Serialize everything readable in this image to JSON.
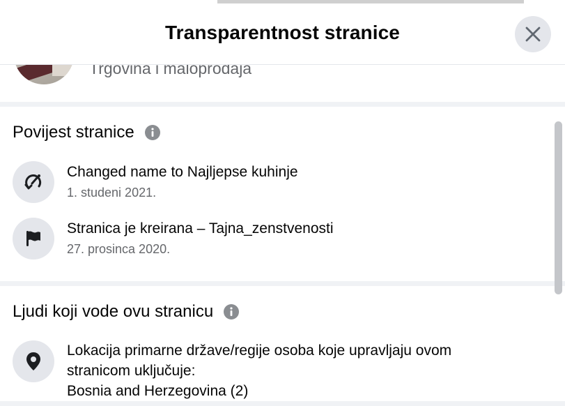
{
  "dialog": {
    "title": "Transparentnost stranice"
  },
  "profile": {
    "category": "Trgovina i maloprodaja"
  },
  "page_history": {
    "title": "Povijest stranice",
    "items": [
      {
        "icon": "name-change-icon",
        "text": "Changed name to Najljepse kuhinje",
        "date": "1. studeni 2021."
      },
      {
        "icon": "flag-icon",
        "text": "Stranica je kreirana – Tajna_zenstvenosti",
        "date": "27. prosinca 2020."
      }
    ]
  },
  "managers": {
    "title": "Ljudi koji vode ovu stranicu",
    "location_lines": [
      "Lokacija primarne države/regije osoba koje upravljaju ovom",
      "stranicom uključuje:",
      "Bosnia and Herzegovina (2)"
    ]
  },
  "colors": {
    "primary_text": "#050505",
    "secondary_text": "#65676b",
    "icon_bg": "#e4e6eb",
    "divider": "#f0f2f5",
    "info_icon": "#8a8d91"
  }
}
